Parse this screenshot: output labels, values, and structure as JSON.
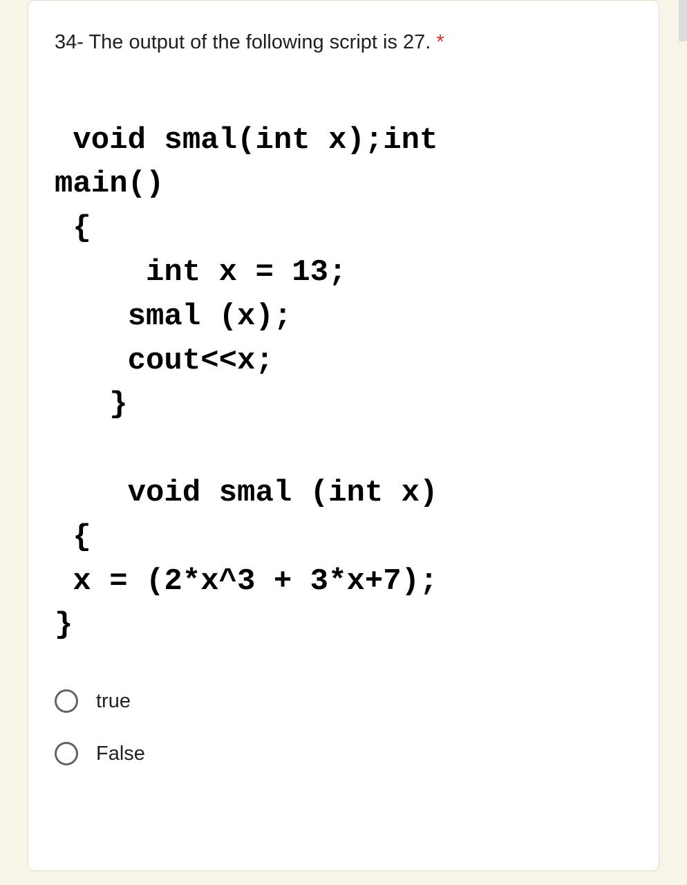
{
  "question": {
    "text": "34- The output of the following script is 27.",
    "required_indicator": "*"
  },
  "code": {
    "line1": " void smal(int x);int",
    "line2": "main()",
    "line3": " {",
    "line4": "     int x = 13;",
    "line5": "    smal (x);",
    "line6": "    cout<<x;",
    "line7": "   }",
    "line8": "",
    "line9": "    void smal (int x)",
    "line10": " {",
    "line11": " x = (2*x^3 + 3*x+7);",
    "line12": "}"
  },
  "options": {
    "opt1": "true",
    "opt2": "False"
  }
}
